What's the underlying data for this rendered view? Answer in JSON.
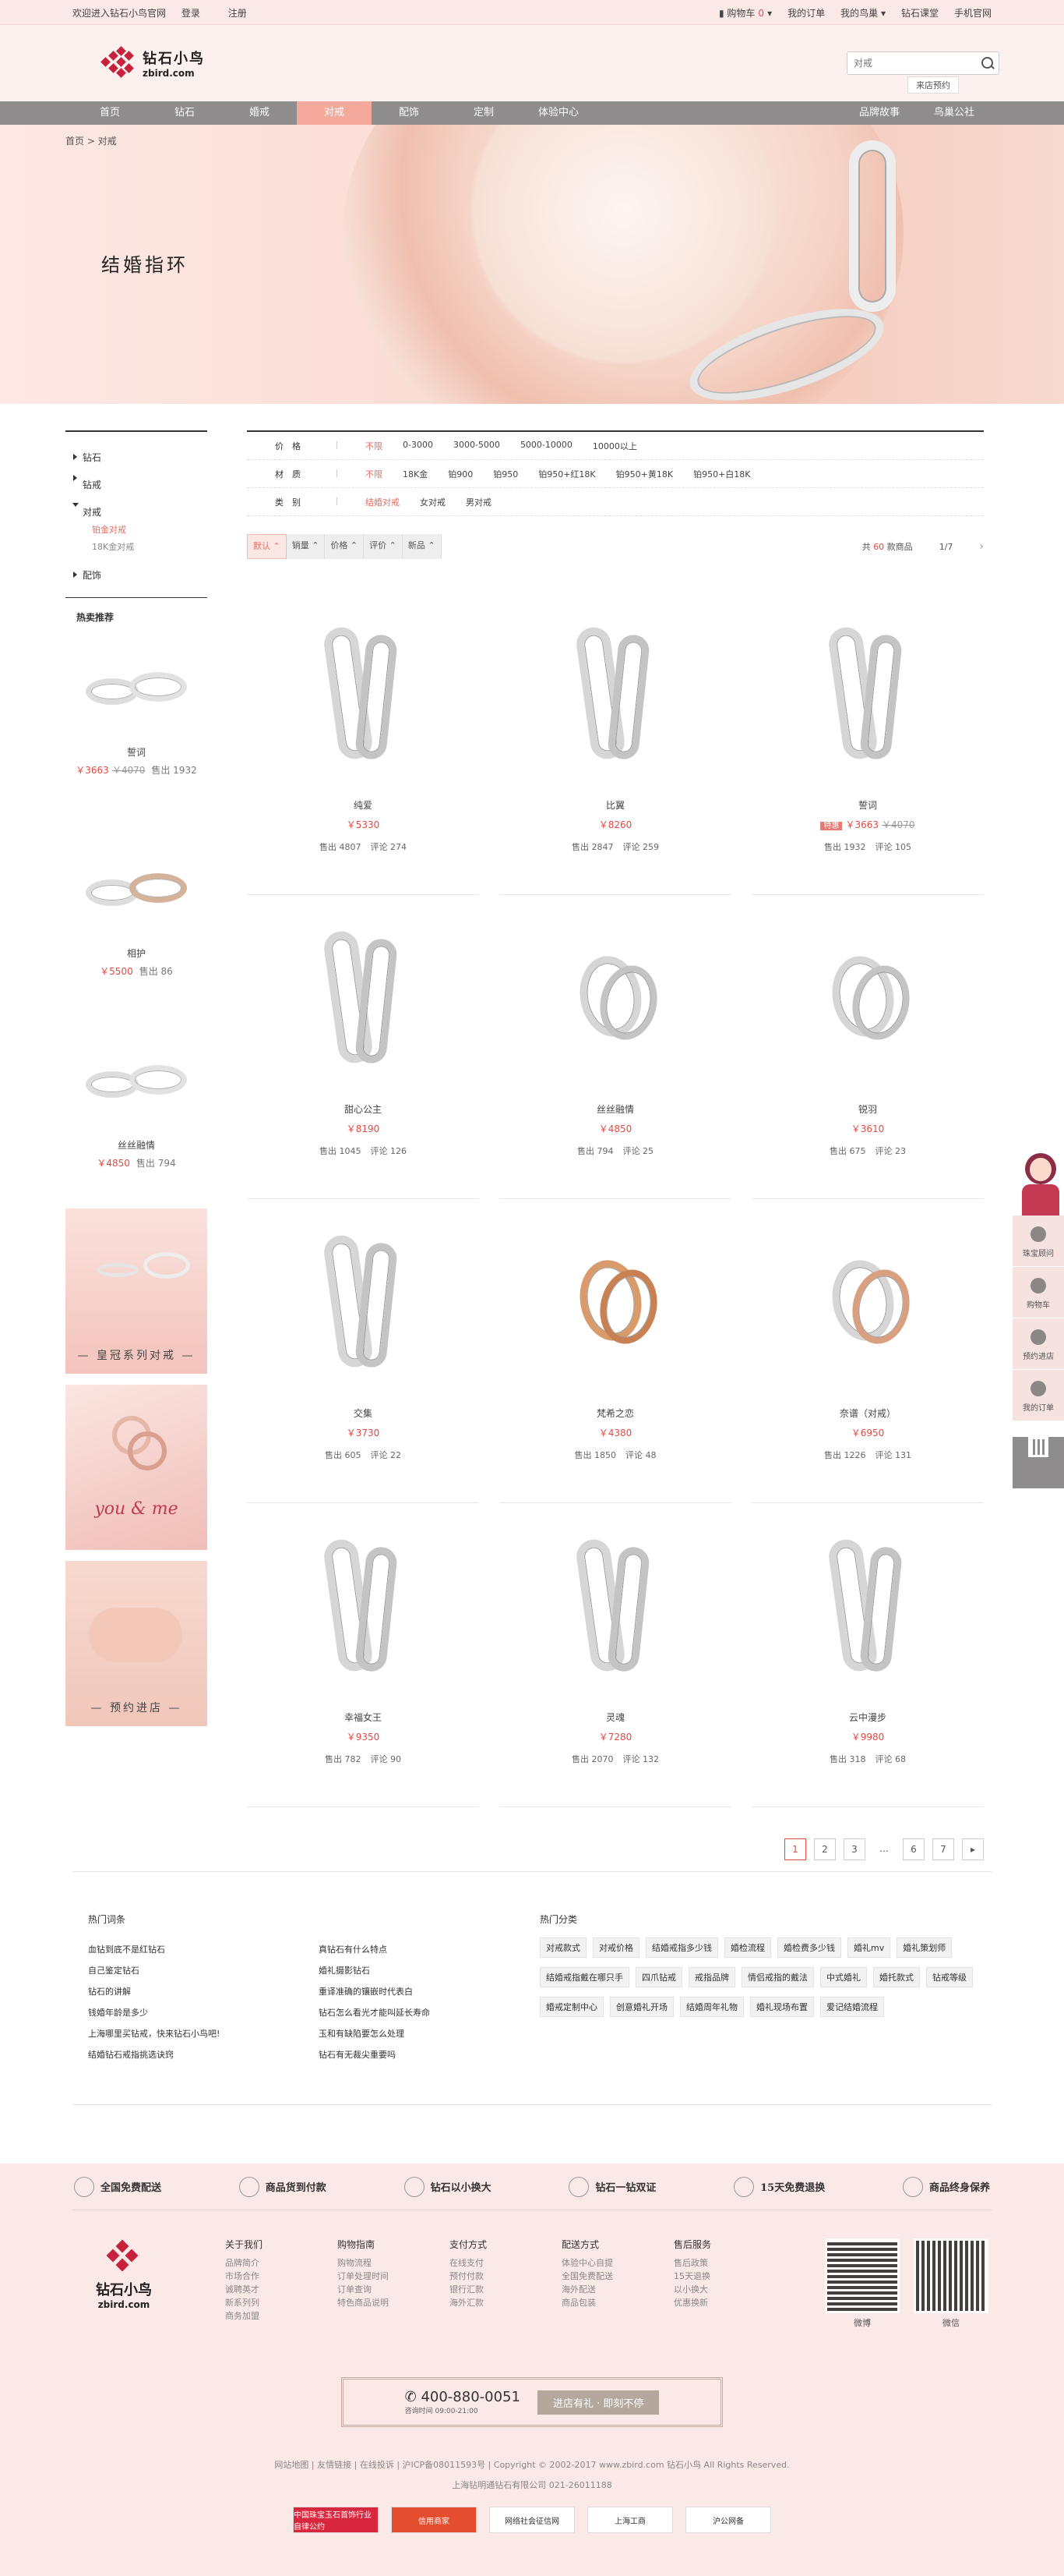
{
  "topbar": {
    "welcome": "欢迎进入钻石小鸟官网",
    "login": "登录",
    "register": "注册",
    "cart_label": "购物车",
    "cart_count": "0",
    "my_orders": "我的订单",
    "my_bird": "我的鸟巢",
    "classroom": "钻石课堂",
    "mobile": "手机官网"
  },
  "header": {
    "logo_cn": "钻石小鸟",
    "logo_en": "zbird.com",
    "search_placeholder": "对戒",
    "store_btn": "来店预约"
  },
  "nav": {
    "items": [
      "首页",
      "钻石",
      "婚戒",
      "对戒",
      "配饰",
      "定制",
      "体验中心"
    ],
    "right": [
      "品牌故事",
      "鸟巢公社"
    ]
  },
  "banner": {
    "breadcrumb": "首页  >  对戒",
    "title": "结婚指环"
  },
  "sidebar": {
    "menu": [
      "钻石",
      "钻戒",
      "对戒",
      "配饰"
    ],
    "sub": [
      "铂金对戒",
      "18K金对戒"
    ],
    "hot_title": "热卖推荐",
    "products": [
      {
        "name": "誓词",
        "price": "￥3663",
        "old": "￥4070",
        "sold": "售出 1932"
      },
      {
        "name": "相护",
        "price": "￥5500",
        "old": "",
        "sold": "售出 86"
      },
      {
        "name": "丝丝融情",
        "price": "￥4850",
        "old": "",
        "sold": "售出 794"
      }
    ],
    "banners": [
      "— 皇冠系列对戒 —",
      "you & me",
      "— 预约进店 —"
    ]
  },
  "filters": [
    {
      "label": "价　格",
      "opts": [
        "不限",
        "0-3000",
        "3000-5000",
        "5000-10000",
        "10000以上"
      ]
    },
    {
      "label": "材　质",
      "opts": [
        "不限",
        "18K金",
        "铂900",
        "铂950",
        "铂950+红18K",
        "铂950+黄18K",
        "铂950+白18K"
      ]
    },
    {
      "label": "类　别",
      "opts": [
        "结婚对戒",
        "女对戒",
        "男对戒"
      ]
    }
  ],
  "sort": {
    "buttons": [
      "默认 ⌃",
      "销量 ⌃",
      "价格 ⌃",
      "评价 ⌃",
      "新品 ⌃"
    ],
    "total_prefix": "共",
    "total": "60",
    "total_suffix": "款商品",
    "page": "1/7",
    "next": "›"
  },
  "products": [
    {
      "name": "纯爱",
      "price": "￥5330",
      "old": "",
      "sold": "售出 4807",
      "reviews": "评论 274",
      "tag": "",
      "metal": "silver"
    },
    {
      "name": "比翼",
      "price": "￥8260",
      "old": "",
      "sold": "售出 2847",
      "reviews": "评论 259",
      "tag": "",
      "metal": "silver"
    },
    {
      "name": "誓词",
      "price": "￥3663",
      "old": "￥4070",
      "sold": "售出 1932",
      "reviews": "评论 105",
      "tag": "特惠",
      "metal": "silver"
    },
    {
      "name": "甜心公主",
      "price": "￥8190",
      "old": "",
      "sold": "售出 1045",
      "reviews": "评论 126",
      "tag": "",
      "metal": "silver"
    },
    {
      "name": "丝丝融情",
      "price": "￥4850",
      "old": "",
      "sold": "售出 794",
      "reviews": "评论 25",
      "tag": "",
      "metal": "silver"
    },
    {
      "name": "锐羽",
      "price": "￥3610",
      "old": "",
      "sold": "售出 675",
      "reviews": "评论 23",
      "tag": "",
      "metal": "silver"
    },
    {
      "name": "交集",
      "price": "￥3730",
      "old": "",
      "sold": "售出 605",
      "reviews": "评论 22",
      "tag": "",
      "metal": "silver"
    },
    {
      "name": "梵希之恋",
      "price": "￥4380",
      "old": "",
      "sold": "售出 1850",
      "reviews": "评论 48",
      "tag": "",
      "metal": "rose"
    },
    {
      "name": "奈谱（对戒）",
      "price": "￥6950",
      "old": "",
      "sold": "售出 1226",
      "reviews": "评论 131",
      "tag": "",
      "metal": "mixed"
    },
    {
      "name": "幸福女王",
      "price": "￥9350",
      "old": "",
      "sold": "售出 782",
      "reviews": "评论 90",
      "tag": "",
      "metal": "silver"
    },
    {
      "name": "灵魂",
      "price": "￥7280",
      "old": "",
      "sold": "售出 2070",
      "reviews": "评论 132",
      "tag": "",
      "metal": "silver"
    },
    {
      "name": "云中漫步",
      "price": "￥9980",
      "old": "",
      "sold": "售出 318",
      "reviews": "评论 68",
      "tag": "",
      "metal": "silver"
    }
  ],
  "pager": [
    "1",
    "2",
    "3",
    "...",
    "6",
    "7",
    "▸"
  ],
  "links": {
    "left_title": "热门词条",
    "col1": [
      "血钻到底不是红钻石",
      "自己鉴定钻石",
      "钻石的讲解",
      "钱婚年龄是多少",
      "上海哪里买钻戒，快来钻石小鸟吧!",
      "结婚钻石戒指挑选诀窍"
    ],
    "col2": [
      "真钻石有什么特点",
      "婚礼摄影钻石",
      "重译准确的镶嵌时代表白",
      "钻石怎么看光才能叫延长寿命",
      "玉和有缺陷要怎么处理",
      "钻石有无裁尖重要吗"
    ],
    "right_title": "热门分类",
    "tags": [
      "对戒款式",
      "对戒价格",
      "结婚戒指多少钱",
      "婚检流程",
      "婚检费多少钱",
      "婚礼mv",
      "婚礼策划师",
      "结婚戒指戴在哪只手",
      "四爪钻戒",
      "戒指品牌",
      "情侣戒指的戴法",
      "中式婚礼",
      "婚托款式",
      "钻戒等级",
      "婚戒定制中心",
      "创意婚礼开场",
      "结婚周年礼物",
      "婚礼现场布置",
      "爱记结婚流程"
    ]
  },
  "service": [
    "全国免费配送",
    "商品货到付款",
    "钻石以小换大",
    "钻石一钻双证",
    "15天免费退换",
    "商品终身保养"
  ],
  "footer": {
    "cols": [
      {
        "title": "关于我们",
        "items": [
          "品牌简介",
          "市场合作",
          "诚聘英才",
          "新系列列",
          "商务加盟"
        ]
      },
      {
        "title": "购物指南",
        "items": [
          "购物流程",
          "订单处理时间",
          "订单查询",
          "特色商品说明"
        ]
      },
      {
        "title": "支付方式",
        "items": [
          "在线支付",
          "预付付款",
          "银行汇款",
          "海外汇款"
        ]
      },
      {
        "title": "配送方式",
        "items": [
          "体验中心自提",
          "全国免费配送",
          "海外配送",
          "商品包装"
        ]
      },
      {
        "title": "售后服务",
        "items": [
          "售后政策",
          "15天退换",
          "以小换大",
          "优惠换新"
        ]
      }
    ],
    "qr_labels": [
      "微博",
      "微信"
    ],
    "hotline": "400-880-0051",
    "hotline_time": "咨询时间 09:00-21:00",
    "hotline_btn": "进店有礼 · 即刻不停",
    "copyright_line1": "网站地图  |  友情链接  |  在线投诉  |  沪ICP备08011593号  |  Copyright © 2002-2017 www.zbird.com 钻石小鸟 All Rights Reserved.",
    "copyright_line2": "上海钻明通钻石有限公司  021-26011188",
    "badges": [
      "中国珠宝玉石首饰行业自律公约",
      "信用商家",
      "网络社会征信网",
      "上海工商",
      "沪公网备"
    ]
  },
  "float": [
    "珠宝顾问",
    "购物车",
    "预约进店",
    "我的订单"
  ],
  "colors": {
    "accent": "#e14a44",
    "nav": "#8e8c8c",
    "nav_active": "#f4a99c",
    "bg_pink": "#fbe9e7"
  }
}
